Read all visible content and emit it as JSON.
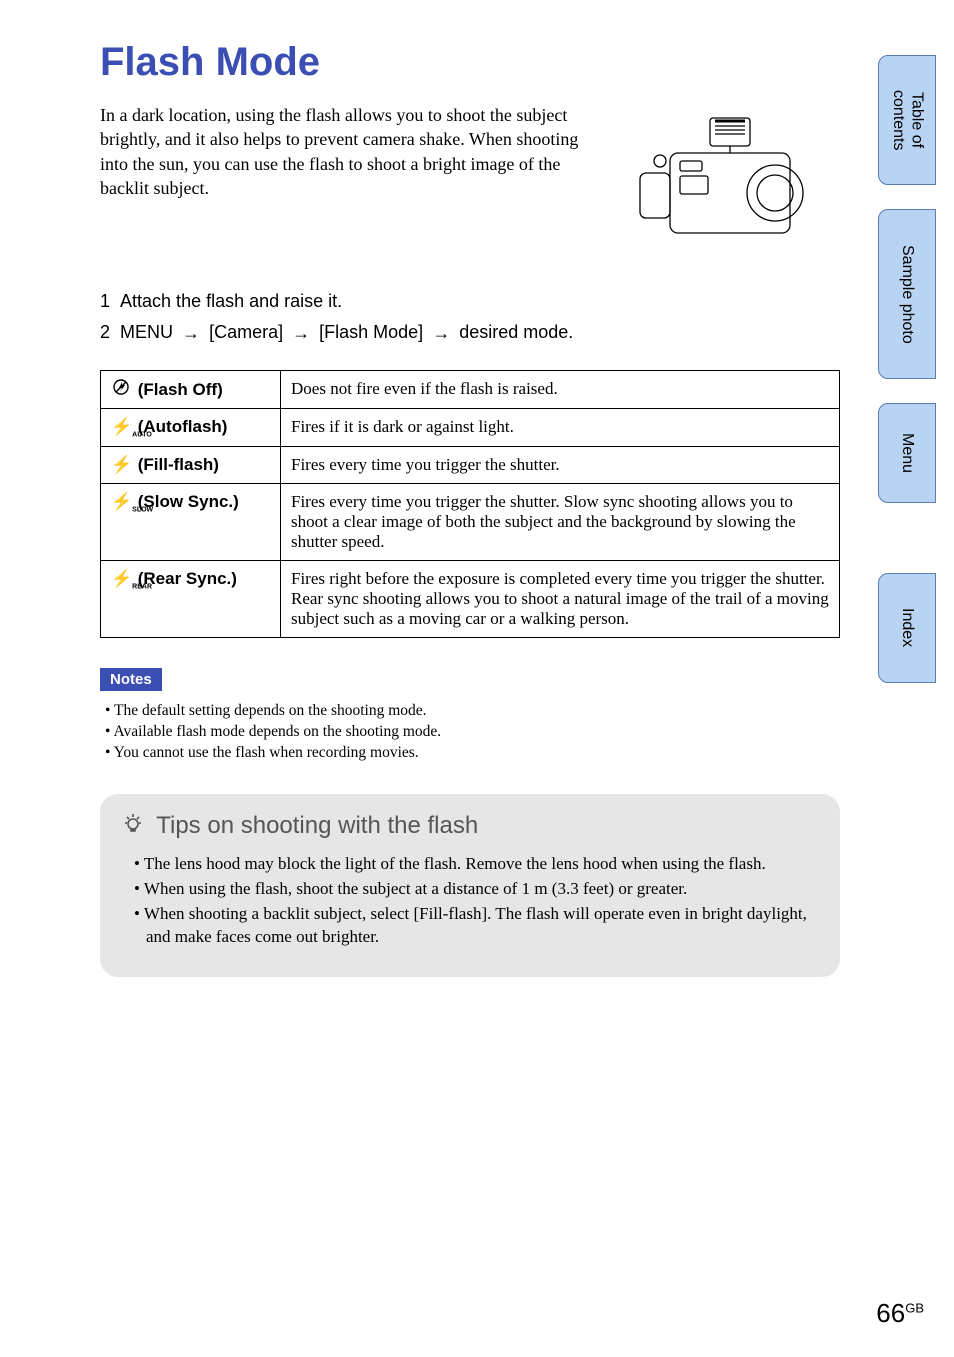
{
  "title": "Flash Mode",
  "intro": "In a dark location, using the flash allows you to shoot the subject brightly, and it also helps to prevent camera shake. When shooting into the sun, you can use the flash to shoot a bright image of the backlit subject.",
  "steps": {
    "s1_num": "1",
    "s1_text": "Attach the flash and raise it.",
    "s2_num": "2",
    "s2_prefix": "MENU",
    "s2_p1": "[Camera]",
    "s2_p2": "[Flash Mode]",
    "s2_p3": "desired mode."
  },
  "modes": [
    {
      "name": "(Flash Off)",
      "desc": "Does not fire even if the flash is raised."
    },
    {
      "name": "(Autoflash)",
      "desc": "Fires if it is dark or against light."
    },
    {
      "name": "(Fill-flash)",
      "desc": "Fires every time you trigger the shutter."
    },
    {
      "name": "(Slow Sync.)",
      "desc": "Fires every time you trigger the shutter. Slow sync shooting allows you to shoot a clear image of both the subject and the background by slowing the shutter speed."
    },
    {
      "name": "(Rear Sync.)",
      "desc": "Fires right before the exposure is completed every time you trigger the shutter. Rear sync shooting allows you to shoot a natural image of the trail of a moving subject such as a moving car or a walking person."
    }
  ],
  "notes_label": "Notes",
  "notes": [
    "The default setting depends on the shooting mode.",
    "Available flash mode depends on the shooting mode.",
    "You cannot use the flash when recording movies."
  ],
  "tips_heading": "Tips on shooting with the flash",
  "tips": [
    "The lens hood may block the light of the flash. Remove the lens hood when using the flash.",
    "When using the flash, shoot the subject at a distance of 1 m (3.3 feet) or greater.",
    "When shooting a backlit subject, select [Fill-flash]. The flash will operate even in bright daylight, and make faces come out brighter."
  ],
  "side_tabs": {
    "toc": "Table of contents",
    "sample": "Sample photo",
    "menu": "Menu",
    "index": "Index"
  },
  "page_number": "66",
  "page_suffix": "GB"
}
